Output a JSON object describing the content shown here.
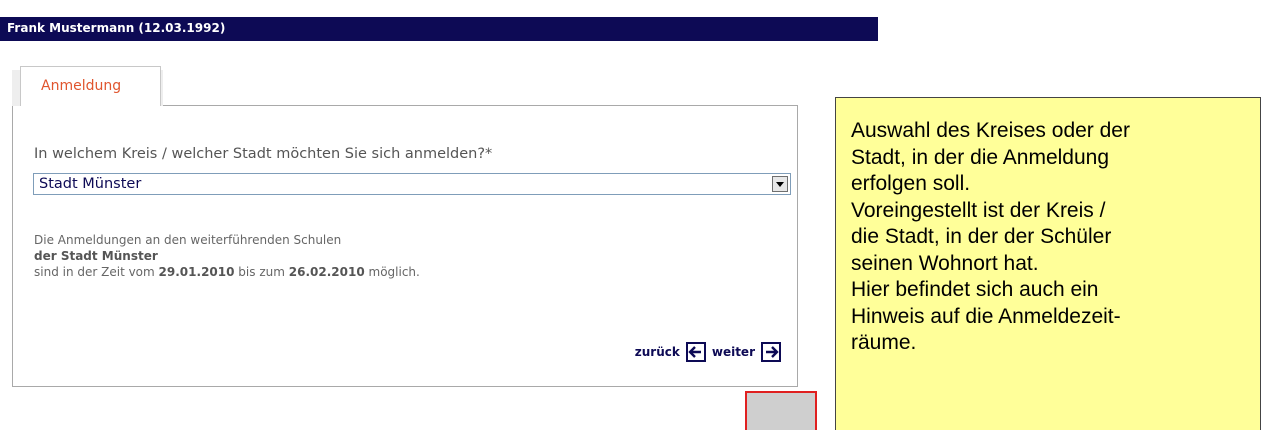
{
  "header": {
    "title": "Frank Mustermann (12.03.1992)"
  },
  "tabs": [
    {
      "label": "Anmeldung",
      "active": true
    }
  ],
  "form": {
    "question": "In welchem Kreis / welcher Stadt möchten Sie sich anmelden?*",
    "select_value": "Stadt Münster"
  },
  "info": {
    "line1": "Die Anmeldungen an den weiterführenden Schulen",
    "line2": "der Stadt Münster",
    "line3_prefix": "sind in der Zeit vom",
    "date_from": "29.01.2010",
    "line3_mid": "bis zum",
    "date_to": "26.02.2010",
    "line3_suffix": "möglich."
  },
  "nav": {
    "back_label": "zurück",
    "next_label": "weiter",
    "back_icon": "arrow-left-icon",
    "next_icon": "arrow-right-icon"
  },
  "annotation": {
    "lines": [
      "Auswahl des Kreises oder der",
      "Stadt, in der die Anmeldung",
      "erfolgen soll.",
      "Voreingestellt ist der Kreis /",
      "die Stadt, in der der Schüler",
      "seinen Wohnort hat.",
      "Hier befindet sich auch ein",
      "Hinweis auf die Anmeldezeit-",
      "räume."
    ]
  },
  "colors": {
    "header_bg": "#0d0a55",
    "tab_text": "#e0552e",
    "note_bg": "#ffff99",
    "highlight_border": "#e02020"
  }
}
